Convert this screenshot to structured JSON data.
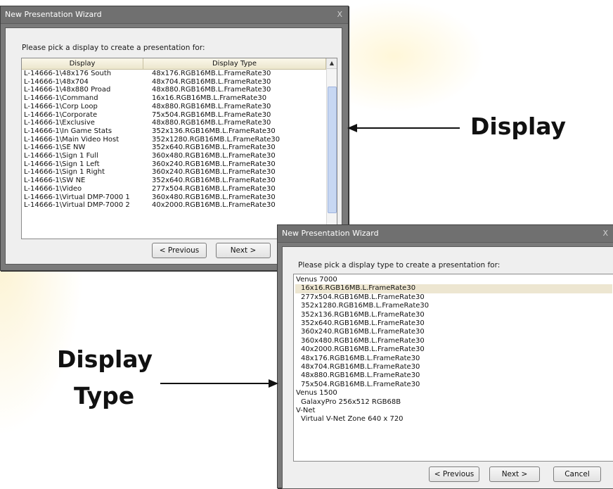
{
  "window1": {
    "title": "New Presentation Wizard",
    "close_glyph": "X",
    "prompt": "Please pick a display to create a presentation for:",
    "columns": [
      "Display",
      "Display Type"
    ],
    "rows": [
      {
        "display": "L-14666-1\\48x176 South",
        "type": "48x176.RGB16MB.L.FrameRate30"
      },
      {
        "display": "L-14666-1\\48x704",
        "type": "48x704.RGB16MB.L.FrameRate30"
      },
      {
        "display": "L-14666-1\\48x880 Proad",
        "type": "48x880.RGB16MB.L.FrameRate30"
      },
      {
        "display": "L-14666-1\\Command",
        "type": "16x16.RGB16MB.L.FrameRate30"
      },
      {
        "display": "L-14666-1\\Corp Loop",
        "type": "48x880.RGB16MB.L.FrameRate30"
      },
      {
        "display": "L-14666-1\\Corporate",
        "type": "75x504.RGB16MB.L.FrameRate30"
      },
      {
        "display": "L-14666-1\\Exclusive",
        "type": "48x880.RGB16MB.L.FrameRate30"
      },
      {
        "display": "L-14666-1\\In Game Stats",
        "type": "352x136.RGB16MB.L.FrameRate30"
      },
      {
        "display": "L-14666-1\\Main Video Host",
        "type": "352x1280.RGB16MB.L.FrameRate30"
      },
      {
        "display": "L-14666-1\\SE NW",
        "type": "352x640.RGB16MB.L.FrameRate30"
      },
      {
        "display": "L-14666-1\\Sign 1 Full",
        "type": "360x480.RGB16MB.L.FrameRate30"
      },
      {
        "display": "L-14666-1\\Sign 1 Left",
        "type": "360x240.RGB16MB.L.FrameRate30"
      },
      {
        "display": "L-14666-1\\Sign 1 Right",
        "type": "360x240.RGB16MB.L.FrameRate30"
      },
      {
        "display": "L-14666-1\\SW NE",
        "type": "352x640.RGB16MB.L.FrameRate30"
      },
      {
        "display": "L-14666-1\\Video",
        "type": "277x504.RGB16MB.L.FrameRate30"
      },
      {
        "display": "L-14666-1\\Virtual DMP-7000 1",
        "type": "360x480.RGB16MB.L.FrameRate30"
      },
      {
        "display": "L-14666-1\\Virtual DMP-7000 2",
        "type": "40x2000.RGB16MB.L.FrameRate30"
      }
    ],
    "buttons": {
      "previous": "< Previous",
      "next": "Next >"
    }
  },
  "window2": {
    "title": "New Presentation Wizard",
    "close_glyph": "X",
    "prompt": "Please pick a display type to create a presentation for:",
    "groups": [
      {
        "name": "Venus 7000",
        "items": [
          "16x16.RGB16MB.L.FrameRate30",
          "277x504.RGB16MB.L.FrameRate30",
          "352x1280.RGB16MB.L.FrameRate30",
          "352x136.RGB16MB.L.FrameRate30",
          "352x640.RGB16MB.L.FrameRate30",
          "360x240.RGB16MB.L.FrameRate30",
          "360x480.RGB16MB.L.FrameRate30",
          "40x2000.RGB16MB.L.FrameRate30",
          "48x176.RGB16MB.L.FrameRate30",
          "48x704.RGB16MB.L.FrameRate30",
          "48x880.RGB16MB.L.FrameRate30",
          "75x504.RGB16MB.L.FrameRate30"
        ]
      },
      {
        "name": "Venus 1500",
        "items": [
          "GalaxyPro 256x512 RGB68B"
        ]
      },
      {
        "name": "V-Net",
        "items": [
          "Virtual V-Net Zone 640 x 720"
        ]
      }
    ],
    "selected_item": "16x16.RGB16MB.L.FrameRate30",
    "buttons": {
      "previous": "< Previous",
      "next": "Next >",
      "cancel": "Cancel"
    }
  },
  "callouts": {
    "display": "Display",
    "display_type_line1": "Display",
    "display_type_line2": "Type"
  },
  "icon_names": [
    "close-icon",
    "scroll-up-icon",
    "arrow-left-icon",
    "arrow-right-icon"
  ]
}
